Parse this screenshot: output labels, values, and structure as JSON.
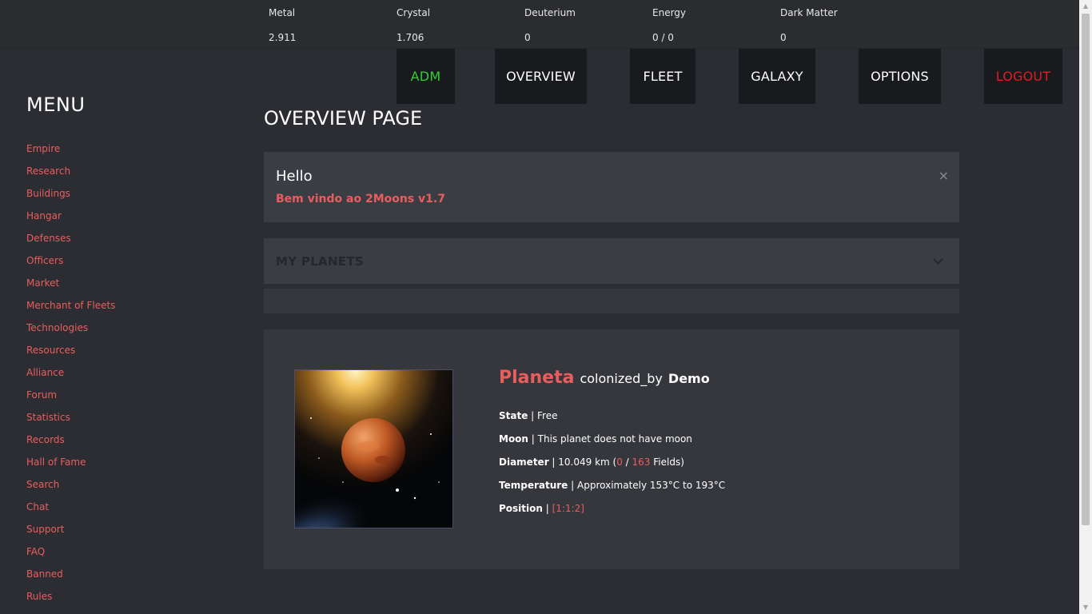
{
  "resources": [
    {
      "name": "Metal",
      "value": "2.911"
    },
    {
      "name": "Crystal",
      "value": "1.706"
    },
    {
      "name": "Deuterium",
      "value": "0"
    },
    {
      "name": "Energy",
      "value": "0 / 0"
    },
    {
      "name": "Dark Matter",
      "value": "0"
    }
  ],
  "nav": {
    "adm": "ADM",
    "overview": "OVERVIEW",
    "fleet": "FLEET",
    "galaxy": "GALAXY",
    "options": "OPTIONS",
    "logout": "LOGOUT"
  },
  "colors": {
    "adm": "#33cc33",
    "logout": "#e01e1e",
    "accent": "#e85e5e"
  },
  "menu": {
    "title": "MENU",
    "items": [
      "Empire",
      "Research",
      "Buildings",
      "Hangar",
      "Defenses",
      "Officers",
      "Market",
      "Merchant of Fleets",
      "Technologies",
      "Resources",
      "Alliance",
      "Forum",
      "Statistics",
      "Records",
      "Hall of Fame",
      "Search",
      "Chat",
      "Support",
      "FAQ",
      "Banned",
      "Rules"
    ]
  },
  "page_title": "OVERVIEW PAGE",
  "hello": {
    "greeting": "Hello",
    "welcome": "Bem vindo ao 2Moons v1.7",
    "close": "×"
  },
  "my_planets": {
    "label": "MY PLANETS"
  },
  "planet": {
    "name": "Planeta",
    "colonized_by": "colonized_by",
    "owner": "Demo",
    "state_label": "State",
    "state_value": "Free",
    "moon_label": "Moon",
    "moon_value": "This planet does not have moon",
    "diameter_label": "Diameter",
    "diameter_value": "10.049 km (",
    "fields_used": "0",
    "fields_sep": " / ",
    "fields_max": "163",
    "fields_suffix": " Fields)",
    "temperature_label": "Temperature",
    "temperature_value": "Approximately 153°C to 193°C",
    "position_label": "Position",
    "position_value": "[1:1:2]",
    "separator": " | "
  }
}
